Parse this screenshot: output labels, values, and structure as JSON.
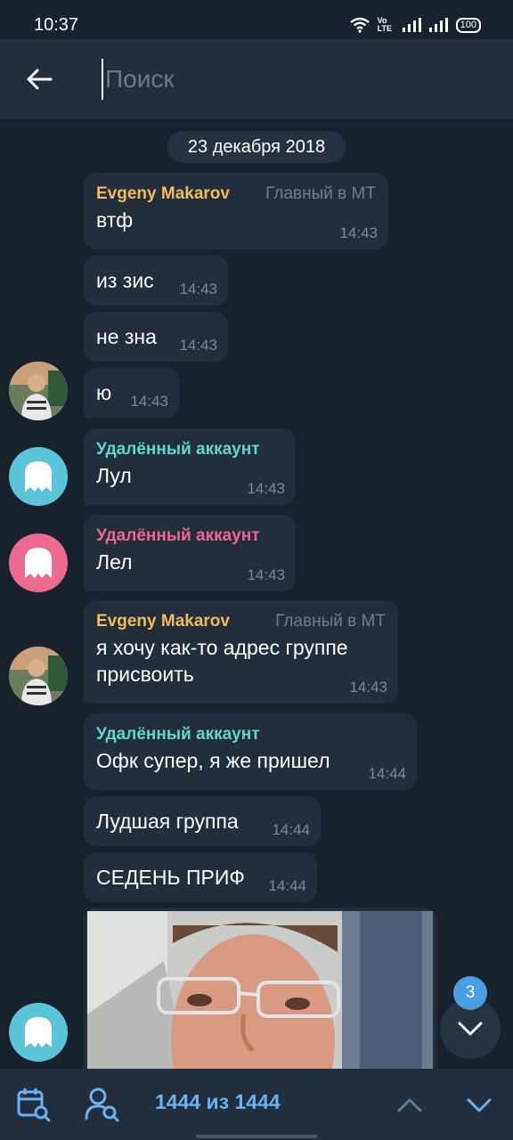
{
  "status_bar": {
    "time": "10:37",
    "volte": "Vo LTE",
    "battery": "100"
  },
  "search": {
    "placeholder": "Поиск",
    "value": ""
  },
  "date_separator": "23 декабря 2018",
  "messages": [
    {
      "sender": "Evgeny Makarov",
      "role": "Главный в МТ",
      "text": "втф",
      "time": "14:43"
    },
    {
      "text": "из зис",
      "time": "14:43"
    },
    {
      "text": "не зна",
      "time": "14:43"
    },
    {
      "text": "ю",
      "time": "14:43"
    },
    {
      "sender": "Удалённый аккаунт",
      "text": "Лул",
      "time": "14:43"
    },
    {
      "sender": "Удалённый аккаунт",
      "text": "Лел",
      "time": "14:43"
    },
    {
      "sender": "Evgeny Makarov",
      "role": "Главный в МТ",
      "text_line1": "я хочу как-то адрес группе",
      "text_line2": "присвоить",
      "time": "14:43"
    },
    {
      "sender": "Удалённый аккаунт",
      "text": "Офк супер, я же пришел",
      "time": "14:44"
    },
    {
      "text": "Лудшая группа",
      "time": "14:44"
    },
    {
      "text": "СЕДЕНЬ ПРИФ",
      "time": "14:44"
    }
  ],
  "colors": {
    "evgeny_name": "#f5b95e",
    "deleted_cyan": "#5fd6d2",
    "deleted_pink": "#f0668f",
    "avatar_cyan": "#5bc4d9",
    "avatar_pink": "#ed6a90",
    "accent": "#6ab3f3"
  },
  "scroll_button": {
    "unread_count": "3"
  },
  "bottom_bar": {
    "counter": "1444 из 1444"
  }
}
